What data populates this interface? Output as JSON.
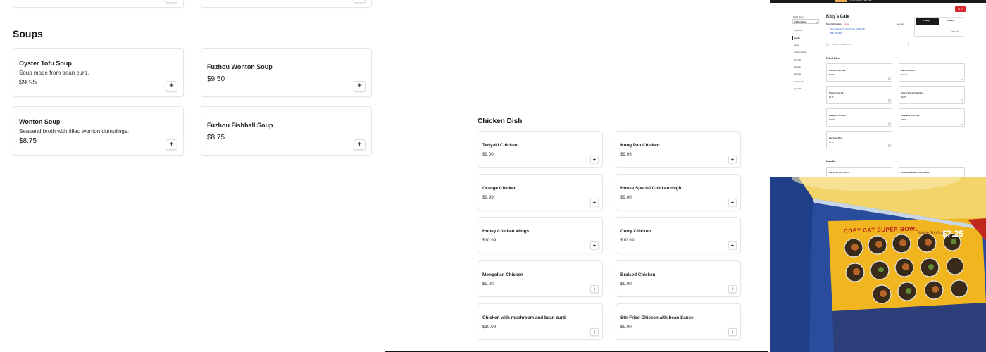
{
  "soups": {
    "heading": "Soups",
    "items": [
      {
        "name": "Oyster Tofu Soup",
        "description": "Soup made from bean curd.",
        "price": "$9.95"
      },
      {
        "name": "Fuzhou Wonton Soup",
        "description": "",
        "price": "$9.50"
      },
      {
        "name": "Wonton Soup",
        "description": "Seasend broth with filled wonton dumplings.",
        "price": "$8.75"
      },
      {
        "name": "Fuzhou Fishball Soup",
        "description": "",
        "price": "$8.75"
      }
    ],
    "add_icon": "plus-icon"
  },
  "chicken": {
    "heading": "Chicken Dish",
    "items": [
      {
        "name": "Teriyaki Chicken",
        "price": "$9.00"
      },
      {
        "name": "Kung Pao Chicken",
        "price": "$9.99"
      },
      {
        "name": "Orange Chicken",
        "price": "$9.99"
      },
      {
        "name": "House Special Chicken thigh",
        "price": "$9.00"
      },
      {
        "name": "Honey Chicken Wings",
        "price": "$10.99"
      },
      {
        "name": "Curry Chicken",
        "price": "$10.99"
      },
      {
        "name": "Mongolian Chicken",
        "price": "$9.00"
      },
      {
        "name": "Braised Chicken",
        "price": "$9.00"
      },
      {
        "name": "Chicken with mushroom and bean curd",
        "price": "$10.99"
      },
      {
        "name": "Stir Fried Chicken aith bean Sauce",
        "price": "$9.00"
      }
    ]
  },
  "mini_page": {
    "cafe_name": "Kitty's Cafe",
    "menu_select": "All Day Menu",
    "menu_select_label": "Select Menu",
    "sidebar": [
      "Fried Rice",
      "Noodle",
      "Soups",
      "Fuzhou Special",
      "Pork Dish",
      "Specials",
      "Beef Dish",
      "Chicken Dish",
      "Vegetable"
    ],
    "store_info_label": "Store Information",
    "store_status": "Closed",
    "address": "2994 Sunbeam St, San Marcos, CA 91 (78)",
    "phone": "(555) 780-8900",
    "see_more": "See more",
    "pickup_label": "Pickup",
    "delivery_label": "Delivery",
    "schedule_label": "Schedule",
    "cart_count": "0",
    "search_placeholder": "Search restaurant items",
    "section_fried_rice": "Fried Rice",
    "fried_rice": [
      {
        "name": "Chicken Fried Rice",
        "price": "$10.75"
      },
      {
        "name": "Beef Fried Rice",
        "price": "$10.75"
      },
      {
        "name": "Shrimp Fried Rice",
        "price": "$9.75"
      },
      {
        "name": "House Special Fried Rice",
        "price": "$9.75"
      },
      {
        "name": "Sausage Fried Rice",
        "price": "$10.75"
      },
      {
        "name": "Vegetable Fried Rice",
        "price": "$8.25"
      },
      {
        "name": "Egg Fried Rice",
        "price": "$8.25"
      }
    ],
    "section_noodle": "Noodle",
    "noodle": [
      {
        "name": "Spicy Beef with Soup N.",
        "price": ""
      },
      {
        "name": "Ground Meat with Brown Sauce",
        "price": ""
      }
    ],
    "banner_text": "You are ordering for later today"
  },
  "photo": {
    "sign_title": "COPY CAT SUPER BOWL",
    "sign_sub": "Made To Order",
    "sign_price": "$7.25"
  },
  "colors": {
    "accent_red": "#d9262a",
    "sign_yellow": "#f1b61f",
    "wall_blue": "#2c4fa0"
  }
}
